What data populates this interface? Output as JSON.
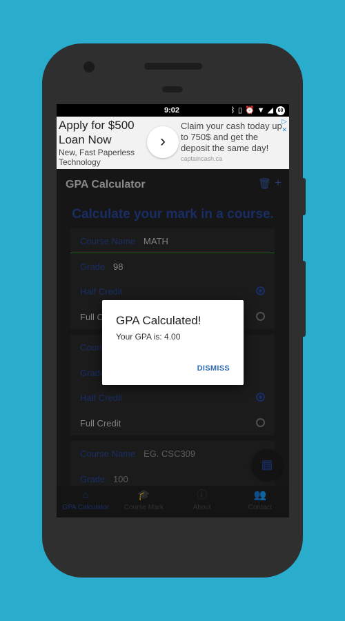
{
  "colors": {
    "background": "#2aaccc",
    "accent": "#27469a",
    "underline": "#2e8b2e",
    "dialog_button": "#2f6bb4"
  },
  "status_bar": {
    "time": "9:02",
    "icons": [
      "bluetooth-icon",
      "vibrate-icon",
      "alarm-icon",
      "wifi-icon",
      "signal-icon",
      "battery-icon"
    ],
    "battery_text": "60"
  },
  "ad": {
    "headline": "Apply for $500 Loan Now",
    "subtext": "New, Fast Paperless Technology",
    "claim": "Claim your cash today up to 750$ and get the deposit the same day!",
    "domain": "captaincash.ca",
    "ad_choices": "▷",
    "close": "✕"
  },
  "appbar": {
    "title": "GPA Calculator",
    "icons": [
      "trash-icon",
      "plus-icon"
    ]
  },
  "heading": "Calculate your mark in a course.",
  "cards": [
    {
      "course_label": "Course Name",
      "course_value": "MATH",
      "grade_label": "Grade",
      "grade_value": "98",
      "half_credit": "Half Credit",
      "full_credit": "Full Credit",
      "half_selected": true
    },
    {
      "course_label": "Course Name",
      "course_value": "",
      "grade_label": "Grade",
      "grade_value": "",
      "half_credit": "Half Credit",
      "full_credit": "Full Credit",
      "half_selected": true
    },
    {
      "course_label": "Course Name",
      "course_value": "EG. CSC309",
      "grade_label": "Grade",
      "grade_value": "100"
    }
  ],
  "bottom_nav": [
    {
      "label": "GPA Calculator",
      "icon": "home-icon",
      "active": true
    },
    {
      "label": "Course Mark",
      "icon": "graduation-cap-icon",
      "active": false
    },
    {
      "label": "About",
      "icon": "info-icon",
      "active": false
    },
    {
      "label": "Contact",
      "icon": "contacts-icon",
      "active": false
    }
  ],
  "dialog": {
    "title": "GPA Calculated!",
    "message": "Your GPA is: 4.00",
    "button": "DISMISS"
  },
  "fab": {
    "icon": "calculator-icon"
  }
}
